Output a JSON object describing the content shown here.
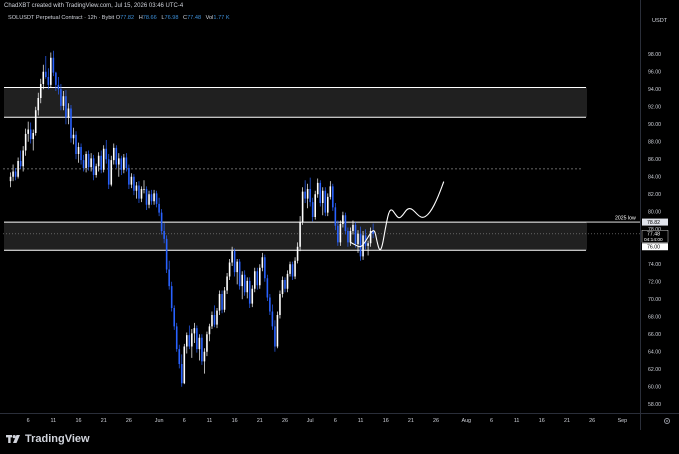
{
  "header": {
    "creator_text": "ChadXBT created with TradingView.com, Jul 15, 2026 03:46 UTC-4"
  },
  "legend": {
    "symbol": "SOLUSDT Perpetual Contract · 12h · Bybit",
    "open_label": "O",
    "open": "77.82",
    "high_label": "H",
    "high": "78.66",
    "low_label": "L",
    "low": "76.98",
    "close_label": "C",
    "close": "77.48",
    "vol_label": "Vol",
    "vol": "1.77 K"
  },
  "brand": {
    "name": "TradingView"
  },
  "colors": {
    "background": "#000000",
    "candle_up": "#ffffff",
    "candle_down": "#2962ff",
    "zone_fill": "#3a3a3a",
    "zone_border": "#ffffff",
    "axis_text": "#d1d4dc",
    "price_tag": "#ffffff"
  },
  "chart_data": {
    "type": "candlestick",
    "currency": "USDT",
    "y_ticks": [
      58,
      60,
      62,
      64,
      66,
      68,
      70,
      72,
      74,
      76,
      78,
      80,
      82,
      84,
      86,
      88,
      90,
      92,
      94,
      96,
      98
    ],
    "ylim": [
      57,
      101
    ],
    "x_ticks": [
      "6",
      "11",
      "16",
      "21",
      "26",
      "Jun",
      "6",
      "11",
      "16",
      "21",
      "26",
      "Jul",
      "6",
      "11",
      "16",
      "21",
      "26",
      "Aug",
      "6",
      "11",
      "16",
      "21",
      "26",
      "Sep"
    ],
    "x_tick_days": [
      5,
      10,
      15,
      20,
      25,
      31,
      36,
      41,
      46,
      51,
      56,
      61,
      66,
      71,
      76,
      81,
      86,
      92,
      97,
      102,
      107,
      112,
      117,
      123
    ],
    "xlim": [
      0,
      126.5
    ],
    "zones": [
      {
        "name": "upper-supply-zone",
        "top": 94.2,
        "bottom": 90.8
      },
      {
        "name": "2025-low-zone",
        "top": 78.82,
        "bottom": 75.6
      }
    ],
    "dotted_levels": [
      84.9
    ],
    "price_labels": [
      {
        "text": "78.82",
        "value": 78.82,
        "style": "light"
      },
      {
        "text": "77.48",
        "value": 77.48,
        "style": "dark",
        "sub": "04:14:00"
      },
      {
        "text": "76.00",
        "value": 76.0,
        "style": "white"
      }
    ],
    "annotations": [
      {
        "text": "2025 low",
        "value": 78.82
      }
    ],
    "current_price": 77.48,
    "candles": [
      [
        1.5,
        83.5,
        84.5,
        82.8,
        84.0
      ],
      [
        2.0,
        84.0,
        85.4,
        83.5,
        84.6
      ],
      [
        2.5,
        84.6,
        85.0,
        83.6,
        84.0
      ],
      [
        3.0,
        84.0,
        86.2,
        83.8,
        85.8
      ],
      [
        3.5,
        85.8,
        87.0,
        84.9,
        85.2
      ],
      [
        4.0,
        85.2,
        87.5,
        84.6,
        87.0
      ],
      [
        4.5,
        87.0,
        89.5,
        86.4,
        88.9
      ],
      [
        5.0,
        88.9,
        90.3,
        88.0,
        89.4
      ],
      [
        5.5,
        89.4,
        90.2,
        87.8,
        88.3
      ],
      [
        6.0,
        88.3,
        89.4,
        87.0,
        89.0
      ],
      [
        6.5,
        89.0,
        92.0,
        88.7,
        91.6
      ],
      [
        7.0,
        91.6,
        93.6,
        91.0,
        93.0
      ],
      [
        7.5,
        93.0,
        95.2,
        92.4,
        94.6
      ],
      [
        8.0,
        94.6,
        96.8,
        94.0,
        96.0
      ],
      [
        8.5,
        96.0,
        97.8,
        95.2,
        95.4
      ],
      [
        9.0,
        95.4,
        96.4,
        94.0,
        94.5
      ],
      [
        9.5,
        94.5,
        98.2,
        94.2,
        97.6
      ],
      [
        10.0,
        97.6,
        98.4,
        95.5,
        95.9
      ],
      [
        10.5,
        95.9,
        96.0,
        93.8,
        94.5
      ],
      [
        11.0,
        94.5,
        95.4,
        93.4,
        94.0
      ],
      [
        11.5,
        94.0,
        94.6,
        91.6,
        92.1
      ],
      [
        12.0,
        92.1,
        93.8,
        91.6,
        93.2
      ],
      [
        12.5,
        93.2,
        93.9,
        90.0,
        90.8
      ],
      [
        13.0,
        90.8,
        92.4,
        90.0,
        91.8
      ],
      [
        13.5,
        91.8,
        92.2,
        87.9,
        88.4
      ],
      [
        14.0,
        88.4,
        89.6,
        87.7,
        88.8
      ],
      [
        14.5,
        88.8,
        89.2,
        86.0,
        86.6
      ],
      [
        15.0,
        86.6,
        87.9,
        85.6,
        87.4
      ],
      [
        15.5,
        87.4,
        87.8,
        85.4,
        85.9
      ],
      [
        16.0,
        85.9,
        86.5,
        84.6,
        85.0
      ],
      [
        16.5,
        85.0,
        86.9,
        84.5,
        86.6
      ],
      [
        17.0,
        86.6,
        87.0,
        84.7,
        85.1
      ],
      [
        17.5,
        85.1,
        86.7,
        84.6,
        86.1
      ],
      [
        18.0,
        86.1,
        86.5,
        83.6,
        84.2
      ],
      [
        18.5,
        84.2,
        85.5,
        83.9,
        85.2
      ],
      [
        19.0,
        85.2,
        86.8,
        84.6,
        86.4
      ],
      [
        19.5,
        86.4,
        87.0,
        84.4,
        84.8
      ],
      [
        20.0,
        84.8,
        87.6,
        84.5,
        87.2
      ],
      [
        20.5,
        87.2,
        88.2,
        85.5,
        86.0
      ],
      [
        21.0,
        86.0,
        86.6,
        82.6,
        83.1
      ],
      [
        21.5,
        83.1,
        86.4,
        82.9,
        85.9
      ],
      [
        22.0,
        85.9,
        87.8,
        85.4,
        87.3
      ],
      [
        22.5,
        87.3,
        87.6,
        85.0,
        85.4
      ],
      [
        23.0,
        85.4,
        86.7,
        84.0,
        86.1
      ],
      [
        23.5,
        86.1,
        86.4,
        84.2,
        84.8
      ],
      [
        24.0,
        84.8,
        86.6,
        84.4,
        86.2
      ],
      [
        24.5,
        86.2,
        86.7,
        84.6,
        85.0
      ],
      [
        25.0,
        85.0,
        85.4,
        82.6,
        83.1
      ],
      [
        25.5,
        83.1,
        84.4,
        82.7,
        84.0
      ],
      [
        26.0,
        84.0,
        84.3,
        81.9,
        82.4
      ],
      [
        26.5,
        82.4,
        83.4,
        81.5,
        83.0
      ],
      [
        27.0,
        83.0,
        83.5,
        81.0,
        81.5
      ],
      [
        27.5,
        81.5,
        82.9,
        81.1,
        82.6
      ],
      [
        28.0,
        82.6,
        83.6,
        82.1,
        82.6
      ],
      [
        28.5,
        82.6,
        82.9,
        80.2,
        80.8
      ],
      [
        29.0,
        80.8,
        82.4,
        80.4,
        82.0
      ],
      [
        29.5,
        82.0,
        82.5,
        80.8,
        81.2
      ],
      [
        30.0,
        81.2,
        82.5,
        80.8,
        82.1
      ],
      [
        30.5,
        82.1,
        82.4,
        80.5,
        80.9
      ],
      [
        31.0,
        80.9,
        81.6,
        79.5,
        79.9
      ],
      [
        31.5,
        79.9,
        80.3,
        77.4,
        77.8
      ],
      [
        32.0,
        77.8,
        78.7,
        76.4,
        76.9
      ],
      [
        32.5,
        76.9,
        77.3,
        73.0,
        73.4
      ],
      [
        33.0,
        73.4,
        74.4,
        71.1,
        71.5
      ],
      [
        33.5,
        71.5,
        72.0,
        68.6,
        69.0
      ],
      [
        34.0,
        69.0,
        69.3,
        66.5,
        66.9
      ],
      [
        34.5,
        66.9,
        67.3,
        64.0,
        64.3
      ],
      [
        35.0,
        64.3,
        64.8,
        62.1,
        62.6
      ],
      [
        35.5,
        62.6,
        63.7,
        60.0,
        60.4
      ],
      [
        36.0,
        60.4,
        64.9,
        60.3,
        64.6
      ],
      [
        36.5,
        64.6,
        66.2,
        63.8,
        65.9
      ],
      [
        37.0,
        65.9,
        67.0,
        64.3,
        64.6
      ],
      [
        37.5,
        64.6,
        66.6,
        63.3,
        66.1
      ],
      [
        38.0,
        66.1,
        67.3,
        65.0,
        66.7
      ],
      [
        38.5,
        66.7,
        67.0,
        63.9,
        64.3
      ],
      [
        39.0,
        64.3,
        66.0,
        63.0,
        65.6
      ],
      [
        39.5,
        65.6,
        66.0,
        62.5,
        62.9
      ],
      [
        40.0,
        62.9,
        64.4,
        61.5,
        64.0
      ],
      [
        40.5,
        64.0,
        66.3,
        63.5,
        66.0
      ],
      [
        41.0,
        66.0,
        67.2,
        65.2,
        66.9
      ],
      [
        41.5,
        66.9,
        68.6,
        66.6,
        68.2
      ],
      [
        42.0,
        68.2,
        69.3,
        66.8,
        67.1
      ],
      [
        42.5,
        67.1,
        69.0,
        66.7,
        68.7
      ],
      [
        43.0,
        68.7,
        71.0,
        68.2,
        70.6
      ],
      [
        43.5,
        70.6,
        71.0,
        68.4,
        68.8
      ],
      [
        44.0,
        68.8,
        71.4,
        68.5,
        71.0
      ],
      [
        44.5,
        71.0,
        73.0,
        70.6,
        72.6
      ],
      [
        45.0,
        72.6,
        74.6,
        72.2,
        74.2
      ],
      [
        45.5,
        74.2,
        76.0,
        73.8,
        75.5
      ],
      [
        46.0,
        75.5,
        75.8,
        72.6,
        73.1
      ],
      [
        46.5,
        73.1,
        74.6,
        71.7,
        74.3
      ],
      [
        47.0,
        74.3,
        74.6,
        71.1,
        71.5
      ],
      [
        47.5,
        71.5,
        73.2,
        70.0,
        72.8
      ],
      [
        48.0,
        72.8,
        73.3,
        70.4,
        70.8
      ],
      [
        48.5,
        70.8,
        72.5,
        70.1,
        72.1
      ],
      [
        49.0,
        72.1,
        72.5,
        69.0,
        69.5
      ],
      [
        49.5,
        69.5,
        71.6,
        69.1,
        71.2
      ],
      [
        50.0,
        71.2,
        73.6,
        70.8,
        73.2
      ],
      [
        50.5,
        73.2,
        73.6,
        71.1,
        71.6
      ],
      [
        51.0,
        71.6,
        74.0,
        71.2,
        73.6
      ],
      [
        51.5,
        73.6,
        75.3,
        73.2,
        74.8
      ],
      [
        52.0,
        74.8,
        75.1,
        72.0,
        72.4
      ],
      [
        52.5,
        72.4,
        72.8,
        69.8,
        70.2
      ],
      [
        53.0,
        70.2,
        70.6,
        68.2,
        68.6
      ],
      [
        53.5,
        68.6,
        69.4,
        66.5,
        66.9
      ],
      [
        54.0,
        66.9,
        67.6,
        64.0,
        64.6
      ],
      [
        54.5,
        64.6,
        68.6,
        64.4,
        68.2
      ],
      [
        55.0,
        68.2,
        71.0,
        67.8,
        70.6
      ],
      [
        55.5,
        70.6,
        72.6,
        70.2,
        72.2
      ],
      [
        56.0,
        72.2,
        72.5,
        70.8,
        71.2
      ],
      [
        56.5,
        71.2,
        73.3,
        70.8,
        72.9
      ],
      [
        57.0,
        72.9,
        74.3,
        72.6,
        74.0
      ],
      [
        57.5,
        74.0,
        74.3,
        72.2,
        72.6
      ],
      [
        58.0,
        72.6,
        74.8,
        72.3,
        74.4
      ],
      [
        58.5,
        74.4,
        76.5,
        74.1,
        76.0
      ],
      [
        59.0,
        76.0,
        79.5,
        75.5,
        78.8
      ],
      [
        59.5,
        78.8,
        82.8,
        78.5,
        82.3
      ],
      [
        60.0,
        82.3,
        83.6,
        81.0,
        81.5
      ],
      [
        60.5,
        81.5,
        83.2,
        80.4,
        82.6
      ],
      [
        61.0,
        82.6,
        83.9,
        80.6,
        81.1
      ],
      [
        61.5,
        81.1,
        81.6,
        78.9,
        79.4
      ],
      [
        62.0,
        79.4,
        82.4,
        79.1,
        82.0
      ],
      [
        62.5,
        82.0,
        83.8,
        81.6,
        83.3
      ],
      [
        63.0,
        83.3,
        83.6,
        80.6,
        81.0
      ],
      [
        63.5,
        81.0,
        82.8,
        79.6,
        82.4
      ],
      [
        64.0,
        82.4,
        82.8,
        79.5,
        79.9
      ],
      [
        64.5,
        79.9,
        82.1,
        79.5,
        81.7
      ],
      [
        65.0,
        81.7,
        83.5,
        81.4,
        82.9
      ],
      [
        65.5,
        82.9,
        83.2,
        80.1,
        80.5
      ],
      [
        66.0,
        80.5,
        81.0,
        77.9,
        78.4
      ],
      [
        66.5,
        78.4,
        79.0,
        76.1,
        76.5
      ],
      [
        67.0,
        76.5,
        79.0,
        76.1,
        78.6
      ],
      [
        67.5,
        78.6,
        80.0,
        78.2,
        79.6
      ],
      [
        68.0,
        79.6,
        79.9,
        77.4,
        77.8
      ],
      [
        68.5,
        77.8,
        78.2,
        76.0,
        76.5
      ],
      [
        69.0,
        76.5,
        78.2,
        76.1,
        77.8
      ],
      [
        69.5,
        77.8,
        79.0,
        77.4,
        78.5
      ],
      [
        70.0,
        78.5,
        78.8,
        75.9,
        76.3
      ],
      [
        70.5,
        76.3,
        77.9,
        75.3,
        77.5
      ],
      [
        71.0,
        77.5,
        78.3,
        74.4,
        74.9
      ],
      [
        71.5,
        74.9,
        77.8,
        74.5,
        77.3
      ],
      [
        72.0,
        77.3,
        78.0,
        75.7,
        76.1
      ],
      [
        72.5,
        76.1,
        76.7,
        75.0,
        76.4
      ],
      [
        73.0,
        76.4,
        78.2,
        76.0,
        77.8
      ],
      [
        73.5,
        77.8,
        78.66,
        76.98,
        77.48
      ]
    ],
    "projection_path": [
      [
        69.0,
        76.5
      ],
      [
        70.0,
        76.2
      ],
      [
        71.0,
        75.9
      ],
      [
        72.0,
        76.6
      ],
      [
        73.0,
        77.6
      ],
      [
        73.8,
        78.0
      ],
      [
        74.3,
        76.5
      ],
      [
        74.8,
        75.5
      ],
      [
        75.3,
        76.0
      ],
      [
        75.9,
        78.0
      ],
      [
        76.6,
        80.0
      ],
      [
        77.2,
        80.3
      ],
      [
        77.8,
        79.8
      ],
      [
        78.6,
        79.2
      ],
      [
        79.4,
        79.6
      ],
      [
        80.2,
        80.3
      ],
      [
        81.0,
        80.4
      ],
      [
        81.8,
        80.0
      ],
      [
        82.6,
        79.5
      ],
      [
        83.4,
        79.3
      ],
      [
        84.3,
        79.6
      ],
      [
        85.2,
        80.3
      ],
      [
        86.0,
        81.2
      ],
      [
        86.8,
        82.3
      ],
      [
        87.5,
        83.4
      ]
    ]
  }
}
